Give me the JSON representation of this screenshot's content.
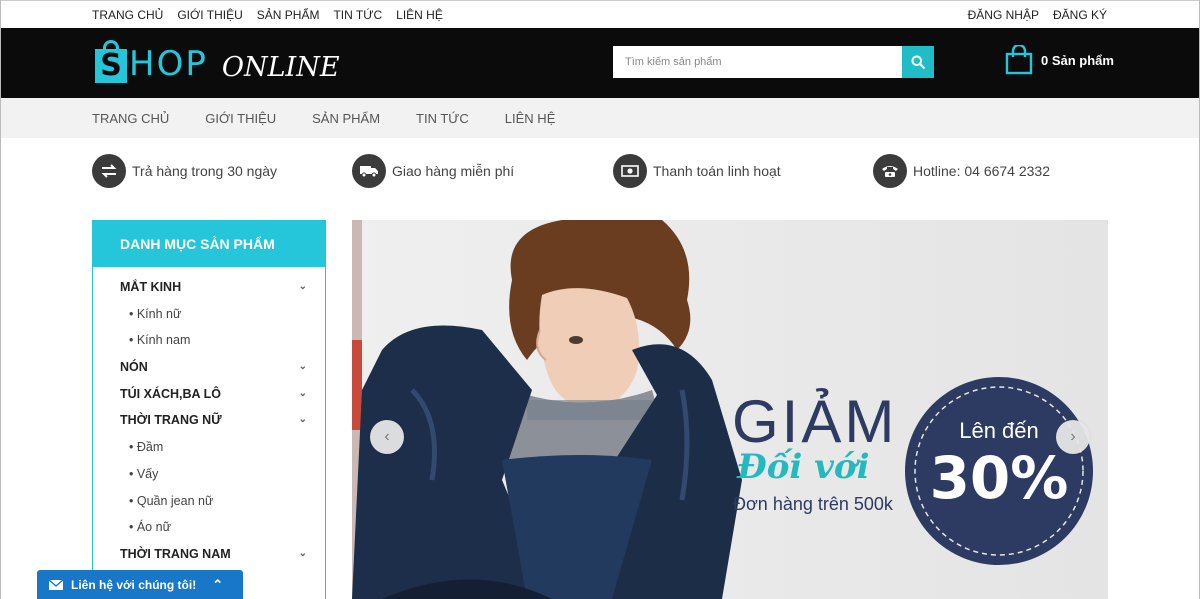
{
  "topbar": {
    "links": [
      "TRANG CHỦ",
      "GIỚI THIỆU",
      "SẢN PHẨM",
      "TIN TỨC",
      "LIÊN HỆ"
    ],
    "login": "ĐĂNG NHẬP",
    "register": "ĐĂNG KÝ"
  },
  "header": {
    "logo_s": "S",
    "logo_hop": "HOP",
    "logo_online": "ONLINE",
    "search_placeholder": "Tìm kiếm sản phẩm",
    "cart_label": "0 Sản phẩm"
  },
  "nav": {
    "items": [
      "TRANG CHỦ",
      "GIỚI THIỆU",
      "SẢN PHẨM",
      "TIN TỨC",
      "LIÊN HỆ"
    ]
  },
  "features": [
    {
      "icon": "exchange-icon",
      "text": "Trả hàng trong 30 ngày"
    },
    {
      "icon": "truck-icon",
      "text": "Giao hàng miễn phí"
    },
    {
      "icon": "money-icon",
      "text": "Thanh toán linh hoạt"
    },
    {
      "icon": "phone-icon",
      "text": "Hotline: 04 6674 2332"
    }
  ],
  "sidebar": {
    "title": "DANH MỤC SẢN PHẨM",
    "categories": [
      {
        "label": "MẮT KINH",
        "type": "main",
        "expandable": true
      },
      {
        "label": "• Kính nữ",
        "type": "sub"
      },
      {
        "label": "• Kính nam",
        "type": "sub"
      },
      {
        "label": "NÓN",
        "type": "main",
        "expandable": true
      },
      {
        "label": "TÚI XÁCH,BA LÔ",
        "type": "main",
        "expandable": true
      },
      {
        "label": "THỜI TRANG NỮ",
        "type": "main",
        "expandable": true
      },
      {
        "label": "• Đầm",
        "type": "sub"
      },
      {
        "label": "• Vấy",
        "type": "sub"
      },
      {
        "label": "• Quần jean nữ",
        "type": "sub"
      },
      {
        "label": "• Áo nữ",
        "type": "sub"
      },
      {
        "label": "THỜI TRANG NAM",
        "type": "main",
        "expandable": true
      }
    ]
  },
  "banner": {
    "headline": "GIẢM",
    "script": "Đối với",
    "subline": "Đơn hàng trên 500k",
    "badge_top": "Lên đến",
    "badge_value": "30%",
    "colors": {
      "navy": "#2d3a62",
      "teal": "#24b9bf"
    }
  },
  "chat": {
    "label": "Liên hệ với chúng tôi!"
  },
  "colors": {
    "accent": "#26c6da",
    "header_bg": "#0b0b0b",
    "chat_bg": "#1877c9"
  }
}
